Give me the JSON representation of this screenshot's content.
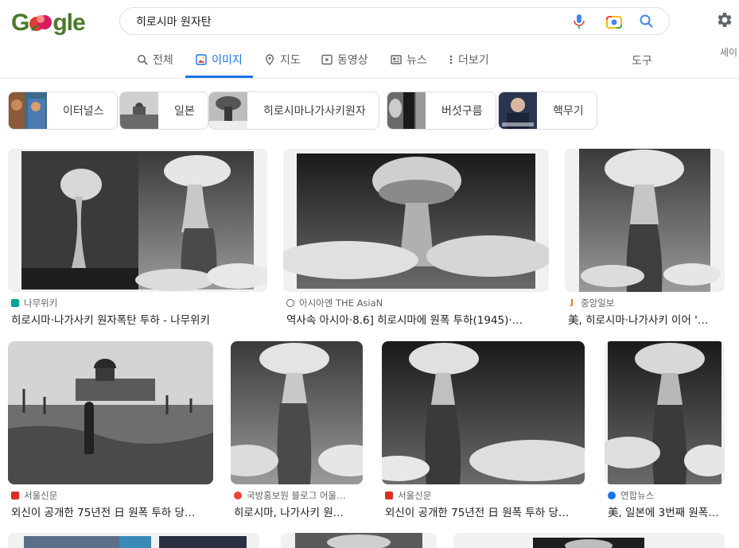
{
  "logo": {
    "left": "G",
    "right": "gle"
  },
  "search": {
    "query": "히로시마 원자탄"
  },
  "tabs": [
    {
      "label": "전체",
      "icon": "search-icon"
    },
    {
      "label": "이미지",
      "icon": "image-icon"
    },
    {
      "label": "지도",
      "icon": "map-pin-icon"
    },
    {
      "label": "동영상",
      "icon": "video-icon"
    },
    {
      "label": "뉴스",
      "icon": "news-icon"
    },
    {
      "label": "더보기",
      "icon": "more-vert-icon"
    }
  ],
  "tools_label": "도구",
  "safesearch_cut": "세이",
  "chips": [
    {
      "label": "이터널스"
    },
    {
      "label": "일본"
    },
    {
      "label": "히로시마나가사키원자"
    },
    {
      "label": "버섯구름"
    },
    {
      "label": "핵무기"
    }
  ],
  "results": [
    {
      "source": "나무위키",
      "title": "히로시마·나가사키 원자폭탄 투하 - 나무위키",
      "favicon_color": "#00a495"
    },
    {
      "source": "아시아엔 THE AsiaN",
      "title": "역사속 아시아·8.6] 히로시마에 원폭 투하(1945)·…",
      "favicon_color": "#5f6368"
    },
    {
      "source": "중앙일보",
      "title": "美, 히로시마·나가사키 이어 '…",
      "favicon_color": "#e8710a"
    },
    {
      "source": "서울신문",
      "title": "외신이 공개한 75년전 日 원폭 투하 당…",
      "favicon_color": "#d93025"
    },
    {
      "source": "국방홍보원 블로그 어울…",
      "title": "히로시마, 나가사키 원…",
      "favicon_color": "#ea4335"
    },
    {
      "source": "서울신문",
      "title": "외신이 공개한 75년전 日 원폭 투하 당…",
      "favicon_color": "#d93025"
    },
    {
      "source": "연합뉴스",
      "title": "美, 일본에 3번째 원폭…",
      "favicon_color": "#1a73e8"
    }
  ]
}
